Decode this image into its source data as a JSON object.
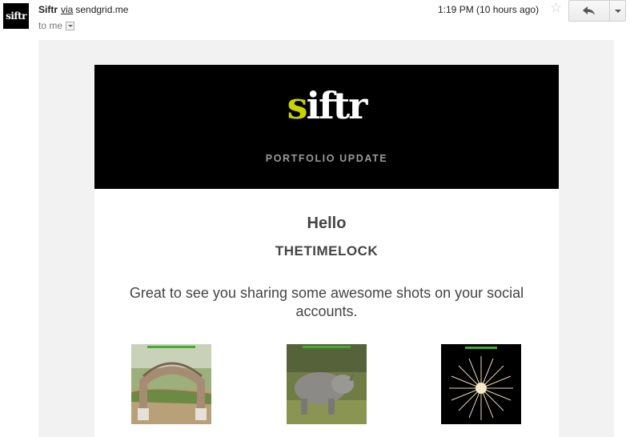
{
  "header": {
    "avatar_text": "siftr",
    "sender_name": "Siftr",
    "via_label": "via",
    "sender_domain": "sendgrid.me",
    "recipient": "to me",
    "timestamp": "1:19 PM (10 hours ago)",
    "star_icon": "star-outline-icon",
    "reply_icon": "reply-arrow-icon",
    "more_icon": "chevron-down-icon"
  },
  "email": {
    "logo_text": "siftr",
    "tagline": "PORTFOLIO UPDATE",
    "greeting": "Hello",
    "username": "THETIMELOCK",
    "message": "Great to see you sharing some awesome shots on your social accounts.",
    "photos": [
      {
        "subject": "stone archway"
      },
      {
        "subject": "rhinoceros"
      },
      {
        "subject": "fireworks"
      }
    ]
  },
  "colors": {
    "banner_bg": "#000000",
    "logo_accent": "#c8d400",
    "body_bg": "#f2f2f2",
    "text": "#444444"
  }
}
